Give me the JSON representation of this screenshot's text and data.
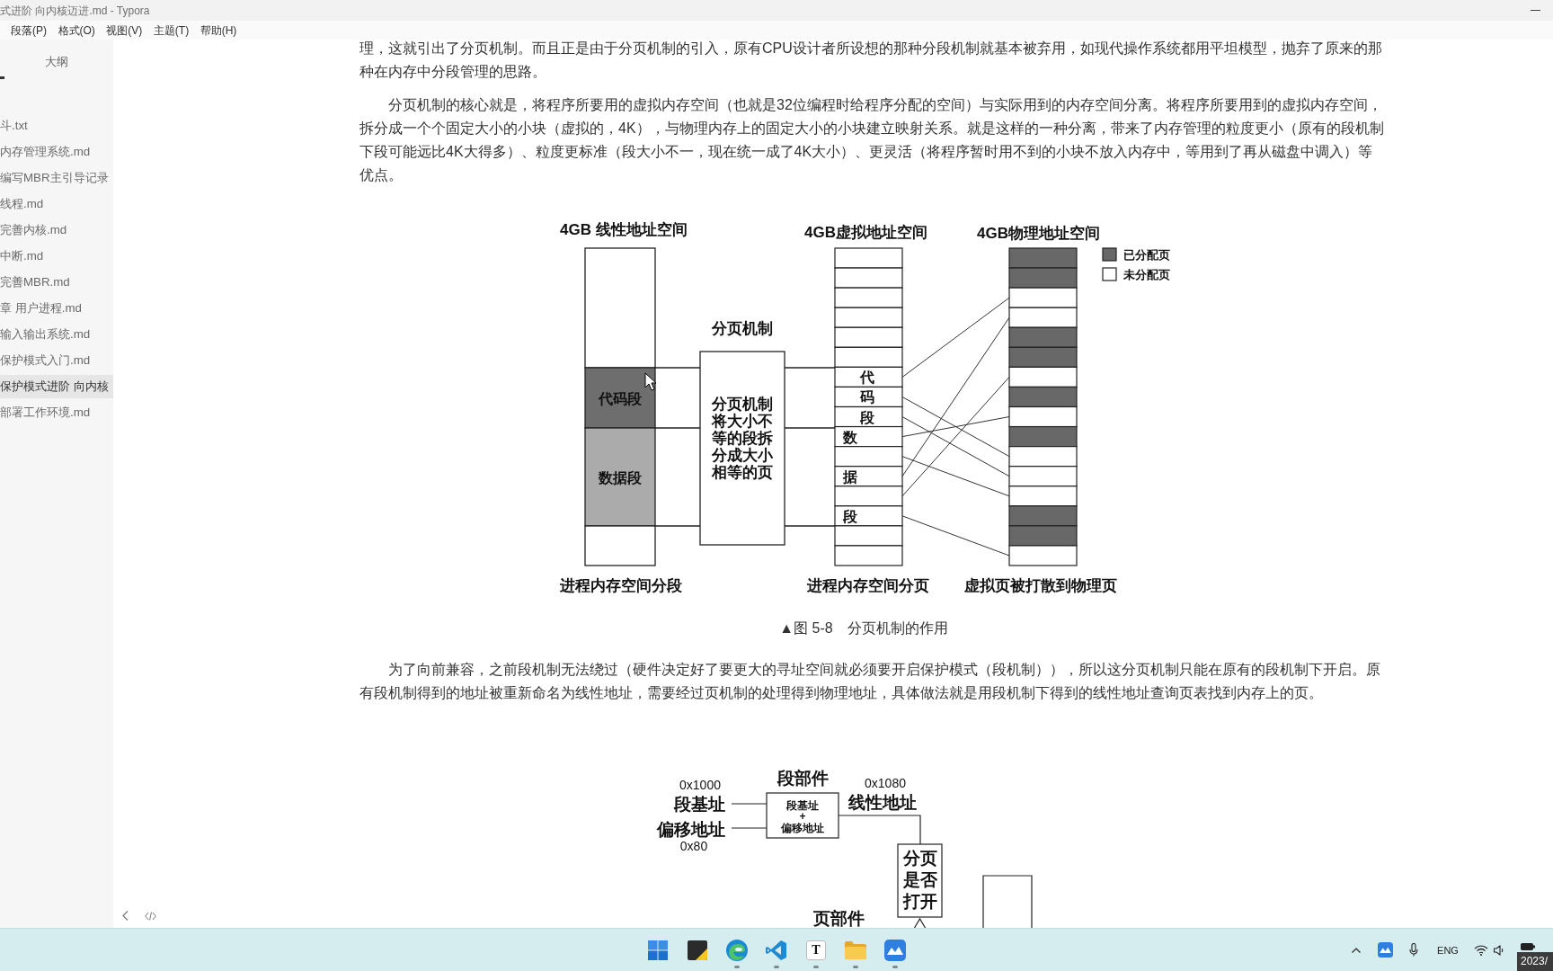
{
  "window": {
    "title": "式进阶 向内核迈进.md - Typora"
  },
  "menu": [
    "段落(P)",
    "格式(O)",
    "视图(V)",
    "主题(T)",
    "帮助(H)"
  ],
  "sidebar": {
    "tabs": [
      {
        "label": "大纲",
        "selected": false
      }
    ],
    "files": [
      {
        "name": "斗.txt",
        "selected": false
      },
      {
        "name": "内存管理系统.md",
        "selected": false
      },
      {
        "name": "编写MBR主引导记录",
        "selected": false
      },
      {
        "name": "线程.md",
        "selected": false
      },
      {
        "name": "完善内核.md",
        "selected": false
      },
      {
        "name": "中断.md",
        "selected": false
      },
      {
        "name": "完善MBR.md",
        "selected": false
      },
      {
        "name": "章 用户进程.md",
        "selected": false
      },
      {
        "name": "输入输出系统.md",
        "selected": false
      },
      {
        "name": "保护模式入门.md",
        "selected": false
      },
      {
        "name": "保护模式进阶 向内核",
        "selected": true
      },
      {
        "name": "部署工作环境.md",
        "selected": false
      }
    ]
  },
  "document": {
    "blocks": [
      {
        "kind": "paragraph",
        "indent": false,
        "text": "理，这就引出了分页机制。而且正是由于分页机制的引入，原有CPU设计者所设想的那种分段机制就基本被弃用，如现代操作系统都用平坦模型，抛弃了原来的那种在内存中分段管理的思路。"
      },
      {
        "kind": "paragraph",
        "indent": true,
        "text": "分页机制的核心就是，将程序所要用的虚拟内存空间（也就是32位编程时给程序分配的空间）与实际用到的内存空间分离。将程序所要用到的虚拟内存空间，拆分成一个个固定大小的小块（虚拟的，4K），与物理内存上的固定大小的小块建立映射关系。就是这样的一种分离，带来了内存管理的粒度更小（原有的段机制下段可能远比4K大得多）、粒度更标准（段大小不一，现在统一成了4K大小）、更灵活（将程序暂时用不到的小块不放入内存中，等用到了再从磁盘中调入）等优点。"
      },
      {
        "kind": "paging_figure",
        "linear": {
          "title": "4GB 线性地址空间",
          "caption": "进程内存空间分段",
          "segments": [
            {
              "kind": "free"
            },
            {
              "kind": "code",
              "label": "代码段"
            },
            {
              "kind": "data",
              "label": "数据段"
            },
            {
              "kind": "free"
            }
          ]
        },
        "mechanism": {
          "title": "分页机制",
          "text": "分页机制将大小不等的段拆分成大小相等的页"
        },
        "virtual": {
          "title": "4GB虚拟地址空间",
          "caption": "进程内存空间分页",
          "pages": [
            {
              "kind": "free"
            },
            {
              "kind": "free"
            },
            {
              "kind": "free"
            },
            {
              "kind": "free"
            },
            {
              "kind": "free"
            },
            {
              "kind": "free"
            },
            {
              "kind": "code",
              "label": "代"
            },
            {
              "kind": "code",
              "label": "码"
            },
            {
              "kind": "code",
              "label": "段"
            },
            {
              "kind": "data",
              "label": "数"
            },
            {
              "kind": "data"
            },
            {
              "kind": "data",
              "label": "据"
            },
            {
              "kind": "data"
            },
            {
              "kind": "data",
              "label": "段"
            },
            {
              "kind": "free"
            },
            {
              "kind": "free"
            }
          ]
        },
        "physical": {
          "title": "4GB物理地址空间",
          "caption": "虚拟页被打散到物理页",
          "pages": [
            {
              "allocated": true
            },
            {
              "allocated": true
            },
            {
              "allocated": false
            },
            {
              "allocated": false
            },
            {
              "allocated": true
            },
            {
              "allocated": true
            },
            {
              "allocated": false
            },
            {
              "allocated": true
            },
            {
              "allocated": false
            },
            {
              "allocated": true
            },
            {
              "allocated": false
            },
            {
              "allocated": false
            },
            {
              "allocated": false
            },
            {
              "allocated": true
            },
            {
              "allocated": true
            },
            {
              "allocated": false
            }
          ]
        },
        "legend": [
          {
            "label": "已分配页",
            "allocated": true
          },
          {
            "label": "未分配页",
            "allocated": false
          }
        ],
        "caption": "▲图 5-8　分页机制的作用"
      },
      {
        "kind": "paragraph",
        "indent": true,
        "text": "为了向前兼容，之前段机制无法绕过（硬件决定好了要更大的寻址空间就必须要开启保护模式（段机制）），所以这分页机制只能在原有的段机制下开启。原有段机制得到的地址被重新命名为线性地址，需要经过页机制的处理得到物理地址，具体做法就是用段机制下得到的线性地址查询页表找到内存上的页。"
      },
      {
        "kind": "address_figure",
        "segment_unit": {
          "title": "段部件",
          "formula": [
            "段基址",
            "+",
            "偏移地址"
          ]
        },
        "inputs": [
          {
            "label": "段基址",
            "value": "0x1000"
          },
          {
            "label": "偏移地址",
            "value": "0x80"
          }
        ],
        "output": {
          "label": "线性地址",
          "value": "0x1080"
        },
        "paging_check": "分页是否打开",
        "page_unit": {
          "title": "页部件"
        }
      }
    ]
  },
  "taskbar": {
    "apps": [
      {
        "kind": "start",
        "running": false
      },
      {
        "kind": "notes",
        "running": false
      },
      {
        "kind": "browser",
        "running": true
      },
      {
        "kind": "code",
        "running": true
      },
      {
        "kind": "letter",
        "label": "T",
        "running": true
      },
      {
        "kind": "folder",
        "running": true
      },
      {
        "kind": "tile",
        "running": true
      }
    ],
    "tray": {
      "language": "ENG",
      "clock": "2023/"
    }
  }
}
